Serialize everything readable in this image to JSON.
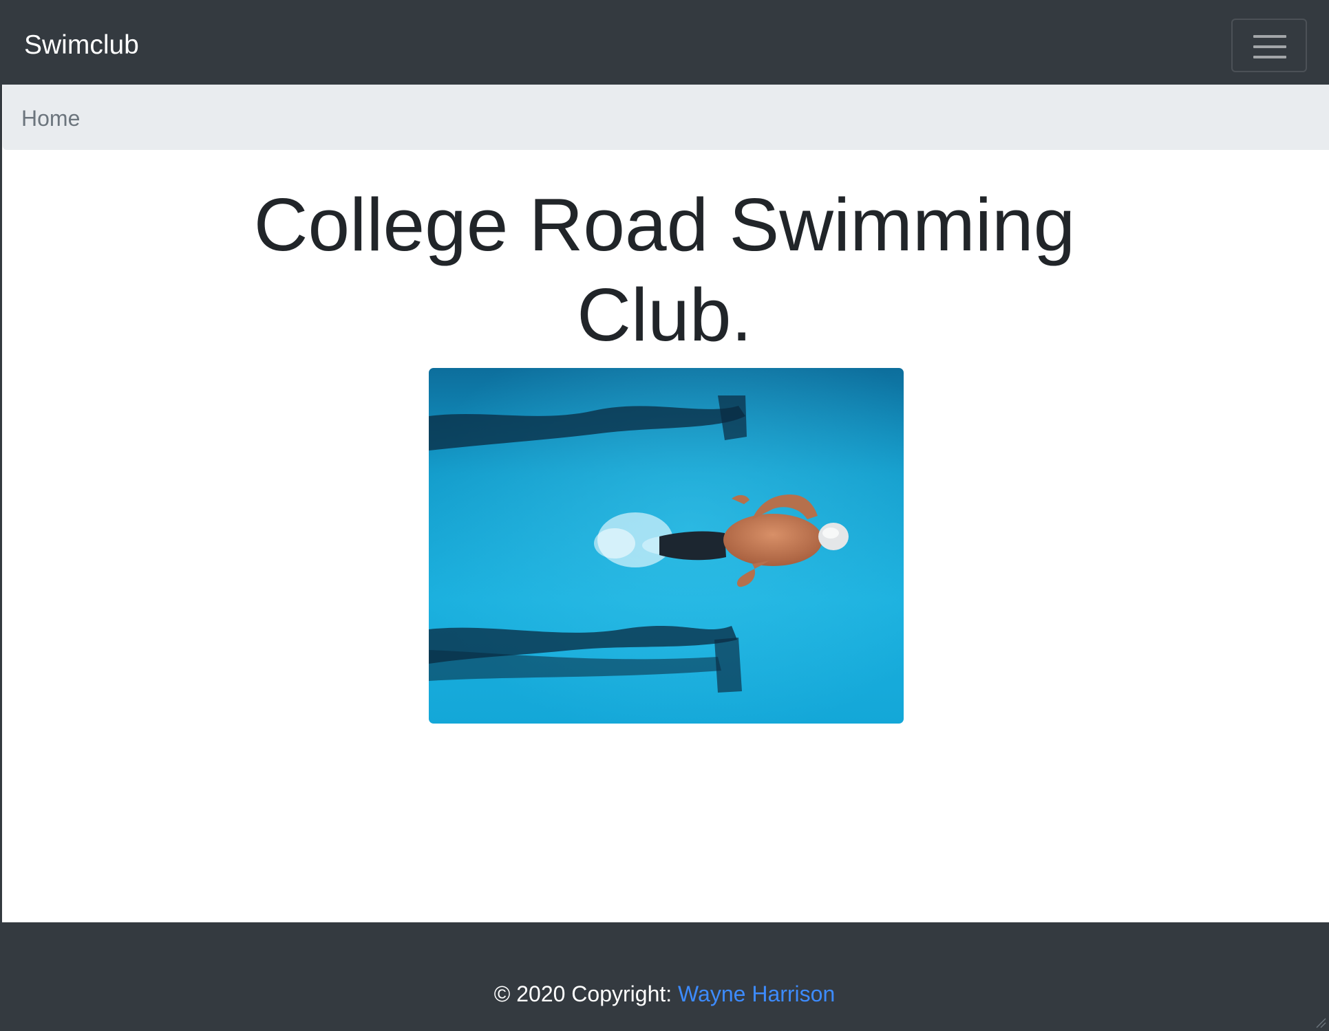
{
  "navbar": {
    "brand": "Swimclub",
    "toggler_icon": "hamburger-menu-icon"
  },
  "breadcrumb": {
    "items": [
      "Home"
    ]
  },
  "main": {
    "title": "College Road Swimming Club.",
    "hero_image": "swimmer-butterfly-pool-photo"
  },
  "footer": {
    "copyright_prefix": "© 2020 Copyright: ",
    "author_link": "Wayne Harrison"
  },
  "colors": {
    "navbar_bg": "#343a40",
    "breadcrumb_bg": "#e9ecef",
    "link": "#3d8bfd",
    "pool_water": "#1aa3cf"
  }
}
